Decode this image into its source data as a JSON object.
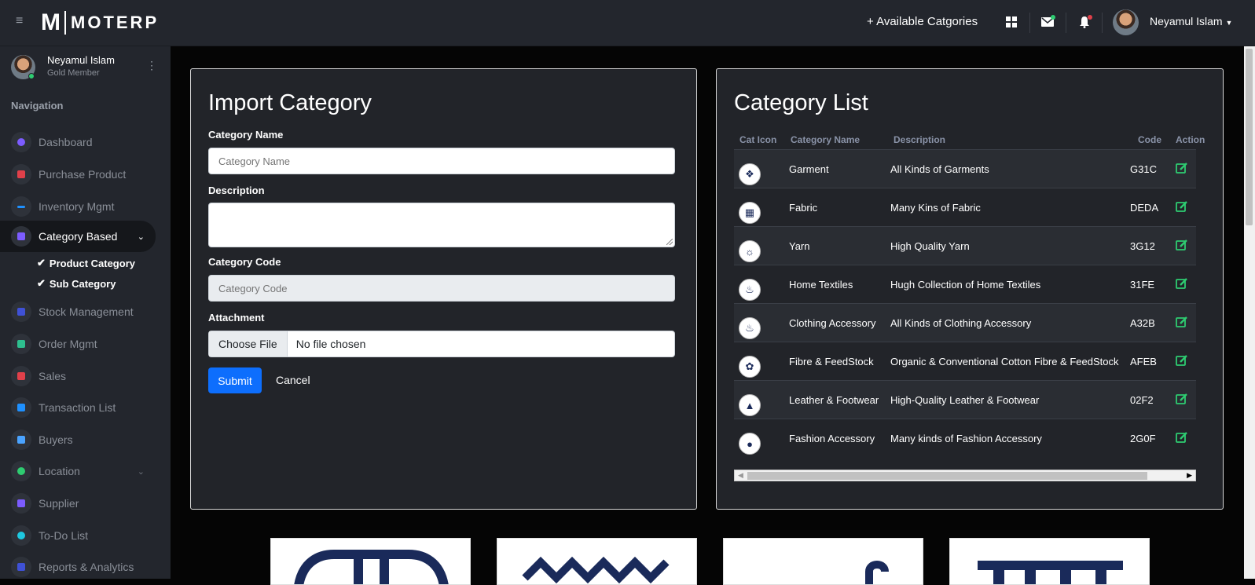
{
  "header": {
    "logo_m": "M",
    "logo_text": "MOTERP",
    "available_categories": "+ Available Catgories",
    "user_name": "Neyamul Islam",
    "icons": [
      "apps-grid-icon",
      "mail-icon",
      "bell-icon"
    ]
  },
  "sidebar": {
    "user_name": "Neyamul Islam",
    "user_role": "Gold Member",
    "nav_heading": "Navigation",
    "items": [
      {
        "label": "Dashboard",
        "color": "#7c5cff"
      },
      {
        "label": "Purchase Product",
        "color": "#e0404a"
      },
      {
        "label": "Inventory Mgmt",
        "color": "#1e90ff"
      },
      {
        "label": "Category Based",
        "color": "#7c5cff"
      },
      {
        "label": "Stock Management",
        "color": "#3f51d6"
      },
      {
        "label": "Order Mgmt",
        "color": "#2ebf8f"
      },
      {
        "label": "Sales",
        "color": "#e0404a"
      },
      {
        "label": "Transaction List",
        "color": "#1e90ff"
      },
      {
        "label": "Buyers",
        "color": "#4aa3ff"
      },
      {
        "label": "Location",
        "color": "#2ecc71"
      },
      {
        "label": "Supplier",
        "color": "#7c5cff"
      },
      {
        "label": "To-Do List",
        "color": "#1ec8e0"
      },
      {
        "label": "Reports & Analytics",
        "color": "#3f51d6"
      }
    ],
    "sub_items": [
      "Product Category",
      "Sub Category"
    ]
  },
  "import_form": {
    "title": "Import Category",
    "name_label": "Category Name",
    "name_placeholder": "Category Name",
    "description_label": "Description",
    "code_label": "Category Code",
    "code_placeholder": "Category Code",
    "attachment_label": "Attachment",
    "choose_file": "Choose File",
    "no_file": "No file chosen",
    "submit": "Submit",
    "cancel": "Cancel"
  },
  "category_list": {
    "title": "Category List",
    "columns": [
      "Cat Icon",
      "Category Name",
      "Description",
      "Code",
      "Action"
    ],
    "rows": [
      {
        "icon": "garment-icon",
        "name": "Garment",
        "description": "All Kinds of Garments",
        "code": "G31C"
      },
      {
        "icon": "fabric-icon",
        "name": "Fabric",
        "description": "Many Kins of Fabric",
        "code": "DEDA"
      },
      {
        "icon": "yarn-icon",
        "name": "Yarn",
        "description": "High Quality Yarn",
        "code": "3G12"
      },
      {
        "icon": "home-textiles-icon",
        "name": "Home Textiles",
        "description": "Hugh Collection of Home Textiles",
        "code": "31FE"
      },
      {
        "icon": "clothing-accessory-icon",
        "name": "Clothing Accessory",
        "description": "All Kinds of Clothing Accessory",
        "code": "A32B"
      },
      {
        "icon": "fibre-icon",
        "name": "Fibre & FeedStock",
        "description": "Organic & Conventional Cotton Fibre & FeedStock",
        "code": "AFEB"
      },
      {
        "icon": "footwear-icon",
        "name": "Leather & Footwear",
        "description": "High-Quality Leather & Footwear",
        "code": "02F2"
      },
      {
        "icon": "fashion-accessory-icon",
        "name": "Fashion Accessory",
        "description": "Many kinds of Fashion Accessory",
        "code": "2G0F"
      }
    ]
  },
  "colors": {
    "accent": "#0d6efd",
    "edit_green": "#2ecc71",
    "panel": "#222429"
  }
}
